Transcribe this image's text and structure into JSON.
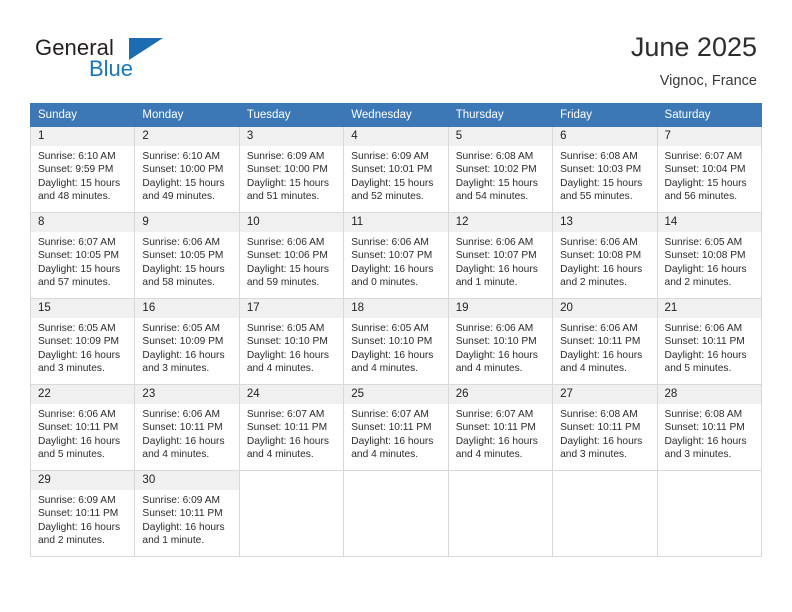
{
  "brand": {
    "line1": "General",
    "line2": "Blue",
    "triangle_color": "#1b6cb0"
  },
  "header": {
    "title": "June 2025",
    "location": "Vignoc, France"
  },
  "colors": {
    "header_row": "#3b78b5",
    "daynum_bg": "#f0f0f0",
    "grid_border": "#d9d9d9",
    "brand_blue": "#1b75bb"
  },
  "weekday_headers": [
    "Sunday",
    "Monday",
    "Tuesday",
    "Wednesday",
    "Thursday",
    "Friday",
    "Saturday"
  ],
  "weeks": [
    [
      {
        "day": "1",
        "sunrise": "Sunrise: 6:10 AM",
        "sunset": "Sunset: 9:59 PM",
        "daylight": "Daylight: 15 hours and 48 minutes."
      },
      {
        "day": "2",
        "sunrise": "Sunrise: 6:10 AM",
        "sunset": "Sunset: 10:00 PM",
        "daylight": "Daylight: 15 hours and 49 minutes."
      },
      {
        "day": "3",
        "sunrise": "Sunrise: 6:09 AM",
        "sunset": "Sunset: 10:00 PM",
        "daylight": "Daylight: 15 hours and 51 minutes."
      },
      {
        "day": "4",
        "sunrise": "Sunrise: 6:09 AM",
        "sunset": "Sunset: 10:01 PM",
        "daylight": "Daylight: 15 hours and 52 minutes."
      },
      {
        "day": "5",
        "sunrise": "Sunrise: 6:08 AM",
        "sunset": "Sunset: 10:02 PM",
        "daylight": "Daylight: 15 hours and 54 minutes."
      },
      {
        "day": "6",
        "sunrise": "Sunrise: 6:08 AM",
        "sunset": "Sunset: 10:03 PM",
        "daylight": "Daylight: 15 hours and 55 minutes."
      },
      {
        "day": "7",
        "sunrise": "Sunrise: 6:07 AM",
        "sunset": "Sunset: 10:04 PM",
        "daylight": "Daylight: 15 hours and 56 minutes."
      }
    ],
    [
      {
        "day": "8",
        "sunrise": "Sunrise: 6:07 AM",
        "sunset": "Sunset: 10:05 PM",
        "daylight": "Daylight: 15 hours and 57 minutes."
      },
      {
        "day": "9",
        "sunrise": "Sunrise: 6:06 AM",
        "sunset": "Sunset: 10:05 PM",
        "daylight": "Daylight: 15 hours and 58 minutes."
      },
      {
        "day": "10",
        "sunrise": "Sunrise: 6:06 AM",
        "sunset": "Sunset: 10:06 PM",
        "daylight": "Daylight: 15 hours and 59 minutes."
      },
      {
        "day": "11",
        "sunrise": "Sunrise: 6:06 AM",
        "sunset": "Sunset: 10:07 PM",
        "daylight": "Daylight: 16 hours and 0 minutes."
      },
      {
        "day": "12",
        "sunrise": "Sunrise: 6:06 AM",
        "sunset": "Sunset: 10:07 PM",
        "daylight": "Daylight: 16 hours and 1 minute."
      },
      {
        "day": "13",
        "sunrise": "Sunrise: 6:06 AM",
        "sunset": "Sunset: 10:08 PM",
        "daylight": "Daylight: 16 hours and 2 minutes."
      },
      {
        "day": "14",
        "sunrise": "Sunrise: 6:05 AM",
        "sunset": "Sunset: 10:08 PM",
        "daylight": "Daylight: 16 hours and 2 minutes."
      }
    ],
    [
      {
        "day": "15",
        "sunrise": "Sunrise: 6:05 AM",
        "sunset": "Sunset: 10:09 PM",
        "daylight": "Daylight: 16 hours and 3 minutes."
      },
      {
        "day": "16",
        "sunrise": "Sunrise: 6:05 AM",
        "sunset": "Sunset: 10:09 PM",
        "daylight": "Daylight: 16 hours and 3 minutes."
      },
      {
        "day": "17",
        "sunrise": "Sunrise: 6:05 AM",
        "sunset": "Sunset: 10:10 PM",
        "daylight": "Daylight: 16 hours and 4 minutes."
      },
      {
        "day": "18",
        "sunrise": "Sunrise: 6:05 AM",
        "sunset": "Sunset: 10:10 PM",
        "daylight": "Daylight: 16 hours and 4 minutes."
      },
      {
        "day": "19",
        "sunrise": "Sunrise: 6:06 AM",
        "sunset": "Sunset: 10:10 PM",
        "daylight": "Daylight: 16 hours and 4 minutes."
      },
      {
        "day": "20",
        "sunrise": "Sunrise: 6:06 AM",
        "sunset": "Sunset: 10:11 PM",
        "daylight": "Daylight: 16 hours and 4 minutes."
      },
      {
        "day": "21",
        "sunrise": "Sunrise: 6:06 AM",
        "sunset": "Sunset: 10:11 PM",
        "daylight": "Daylight: 16 hours and 5 minutes."
      }
    ],
    [
      {
        "day": "22",
        "sunrise": "Sunrise: 6:06 AM",
        "sunset": "Sunset: 10:11 PM",
        "daylight": "Daylight: 16 hours and 5 minutes."
      },
      {
        "day": "23",
        "sunrise": "Sunrise: 6:06 AM",
        "sunset": "Sunset: 10:11 PM",
        "daylight": "Daylight: 16 hours and 4 minutes."
      },
      {
        "day": "24",
        "sunrise": "Sunrise: 6:07 AM",
        "sunset": "Sunset: 10:11 PM",
        "daylight": "Daylight: 16 hours and 4 minutes."
      },
      {
        "day": "25",
        "sunrise": "Sunrise: 6:07 AM",
        "sunset": "Sunset: 10:11 PM",
        "daylight": "Daylight: 16 hours and 4 minutes."
      },
      {
        "day": "26",
        "sunrise": "Sunrise: 6:07 AM",
        "sunset": "Sunset: 10:11 PM",
        "daylight": "Daylight: 16 hours and 4 minutes."
      },
      {
        "day": "27",
        "sunrise": "Sunrise: 6:08 AM",
        "sunset": "Sunset: 10:11 PM",
        "daylight": "Daylight: 16 hours and 3 minutes."
      },
      {
        "day": "28",
        "sunrise": "Sunrise: 6:08 AM",
        "sunset": "Sunset: 10:11 PM",
        "daylight": "Daylight: 16 hours and 3 minutes."
      }
    ],
    [
      {
        "day": "29",
        "sunrise": "Sunrise: 6:09 AM",
        "sunset": "Sunset: 10:11 PM",
        "daylight": "Daylight: 16 hours and 2 minutes."
      },
      {
        "day": "30",
        "sunrise": "Sunrise: 6:09 AM",
        "sunset": "Sunset: 10:11 PM",
        "daylight": "Daylight: 16 hours and 1 minute."
      },
      {
        "day": "",
        "sunrise": "",
        "sunset": "",
        "daylight": ""
      },
      {
        "day": "",
        "sunrise": "",
        "sunset": "",
        "daylight": ""
      },
      {
        "day": "",
        "sunrise": "",
        "sunset": "",
        "daylight": ""
      },
      {
        "day": "",
        "sunrise": "",
        "sunset": "",
        "daylight": ""
      },
      {
        "day": "",
        "sunrise": "",
        "sunset": "",
        "daylight": ""
      }
    ]
  ]
}
